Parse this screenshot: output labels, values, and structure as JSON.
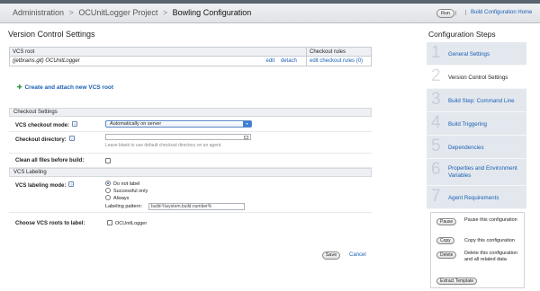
{
  "breadcrumb": {
    "items": [
      "Administration",
      "OCUnitLogger Project",
      "Bowling Configuration"
    ],
    "separator": ">"
  },
  "header": {
    "run_label": "Run",
    "run_menu_glyph": "|",
    "home_link": "Build Configuration Home"
  },
  "main": {
    "title": "Version Control Settings",
    "vcs_table": {
      "headers": [
        "VCS root",
        "",
        "Checkout rules"
      ],
      "rows": [
        {
          "root": "(jetbrains.git) OCUnitLogger",
          "edit": "edit",
          "detach": "detach",
          "rules": "edit checkout rules (0)"
        }
      ]
    },
    "create_link": "Create and attach new VCS root",
    "checkout_section": "Checkout Settings",
    "checkout_mode_label": "VCS checkout mode:",
    "checkout_mode_value": "Automatically on server",
    "checkout_dir_label": "Checkout directory:",
    "checkout_dir_note": "Leave blank to use default checkout directory on an agent.",
    "clean_label": "Clean all files before build:",
    "labeling_section": "VCS Labeling",
    "labeling_mode_label": "VCS labeling mode:",
    "labeling_options": [
      "Do not label",
      "Successful only",
      "Always"
    ],
    "labeling_selected": "Do not label",
    "pattern_label": "Labeling pattern:",
    "pattern_value": "build-%system.build.number%",
    "roots_label": "Choose VCS roots to label:",
    "roots_option": "OCUnitLogger",
    "save_label": "Save",
    "cancel_label": "Cancel"
  },
  "sidebar": {
    "title": "Configuration Steps",
    "steps": [
      {
        "num": "1",
        "label": "General Settings"
      },
      {
        "num": "2",
        "label": "Version Control Settings"
      },
      {
        "num": "3",
        "label": "Build Step: Command Line"
      },
      {
        "num": "4",
        "label": "Build Triggering"
      },
      {
        "num": "5",
        "label": "Dependencies"
      },
      {
        "num": "6",
        "label": "Properties and Environment Variables"
      },
      {
        "num": "7",
        "label": "Agent Requirements"
      }
    ],
    "active_step": 2,
    "actions": {
      "pause": "Pause",
      "pause_desc": "Pause this configuration",
      "copy": "Copy",
      "copy_desc": "Copy this configuration",
      "delete": "Delete",
      "delete_desc": "Delete this configuration and all related data",
      "extract": "Extract Template"
    }
  },
  "colors": {
    "link": "#1a5fb4",
    "accent": "#3d7fd6",
    "step_bg": "#e3e8ee",
    "section_bg": "#eef0f3"
  },
  "icons": {
    "help": "help-icon",
    "plus": "plus-icon",
    "dropdown": "chevron-down-icon",
    "folder": "folder-icon"
  }
}
